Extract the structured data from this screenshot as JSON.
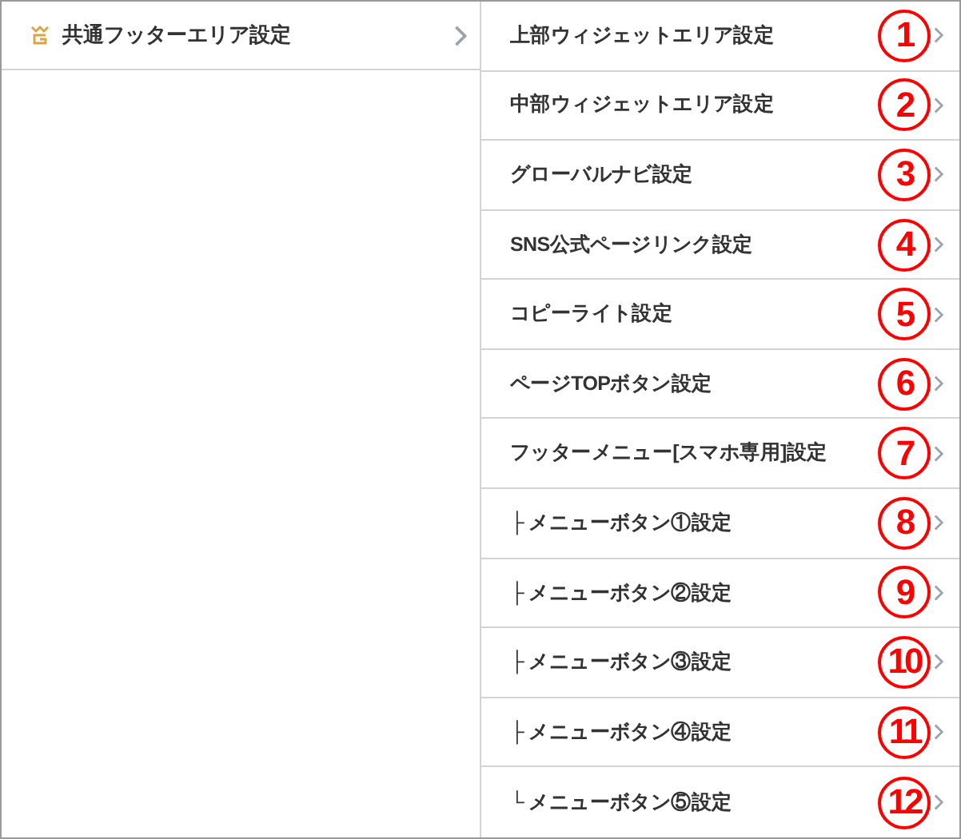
{
  "sidebar": {
    "items": [
      {
        "label": "共通フッターエリア設定"
      }
    ]
  },
  "submenu": {
    "items": [
      {
        "label": "上部ウィジェットエリア設定",
        "marker": "1"
      },
      {
        "label": "中部ウィジェットエリア設定",
        "marker": "2"
      },
      {
        "label": "グローバルナビ設定",
        "marker": "3"
      },
      {
        "label": "SNS公式ページリンク設定",
        "marker": "4"
      },
      {
        "label": "コピーライト設定",
        "marker": "5"
      },
      {
        "label": "ページTOPボタン設定",
        "marker": "6"
      },
      {
        "label": "フッターメニュー[スマホ専用]設定",
        "marker": "7"
      },
      {
        "label": "├ メニューボタン①設定",
        "marker": "8"
      },
      {
        "label": "├ メニューボタン②設定",
        "marker": "9"
      },
      {
        "label": "├ メニューボタン③設定",
        "marker": "10"
      },
      {
        "label": "├ メニューボタン④設定",
        "marker": "11"
      },
      {
        "label": "└ メニューボタン⑤設定",
        "marker": "12"
      }
    ]
  }
}
